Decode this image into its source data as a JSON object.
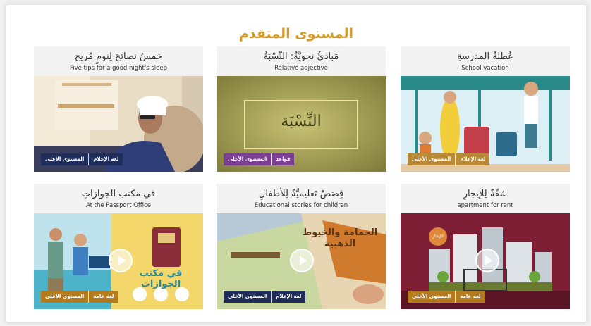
{
  "section": {
    "title": "المستوى المتقدم"
  },
  "cards": [
    {
      "title_ar": "خمسُ نصائحَ لِنومٍ مُريح",
      "title_en": "Five tips for a good night's sleep",
      "tags": [
        "المستوى الأعلى",
        "لغة الإعلام"
      ],
      "tag_color": "#1f2d5a"
    },
    {
      "title_ar": "مَبادئُ نحويَّةٌ: النِّسْبَةُ",
      "title_en": "Relative adjective",
      "thumb_text": "النِّسْبَة",
      "tags": [
        "المستوى الأعلى",
        "قواعد"
      ],
      "tag_color": "#7a3f93"
    },
    {
      "title_ar": "عُطلةُ المدرسةِ",
      "title_en": "School vacation",
      "tags": [
        "المستوى الأعلى",
        "لغة الإعلام"
      ],
      "tag_color": "#b88a38"
    },
    {
      "title_ar": "في مَكتبِ الجوازاتِ",
      "title_en": "At the Passport Office",
      "thumb_text": "في مكتب الجوازات",
      "tags": [
        "المستوى الأعلى",
        "لغة عامة"
      ],
      "tag_color": "#b47a1e"
    },
    {
      "title_ar": "قِصَصٌ تَعليميَّةٌ لِلأطفالِ",
      "title_en": "Educational stories for children",
      "thumb_text": "الحمامة والخيوط الذهبية",
      "tags": [
        "المستوى الأعلى",
        "لغة الإعلام"
      ],
      "tag_color": "#1f2d5a"
    },
    {
      "title_ar": "شقّةٌ لِلإيجارِ",
      "title_en": "apartment for rent",
      "thumb_text": "للإيجار",
      "tags": [
        "المستوى الأعلى",
        "لغة عامة"
      ],
      "tag_color": "#b47a1e"
    }
  ],
  "icons": {
    "play": "play-icon"
  }
}
